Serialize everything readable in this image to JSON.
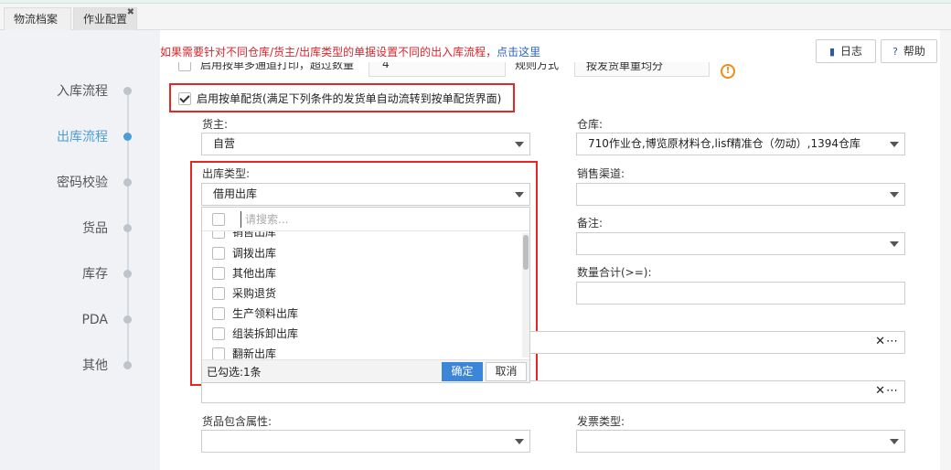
{
  "tabs": [
    {
      "label": "物流档案"
    },
    {
      "label": "作业配置",
      "close": "✖"
    }
  ],
  "sidebar": {
    "items": [
      {
        "label": "入库流程",
        "active": false
      },
      {
        "label": "出库流程",
        "active": true
      },
      {
        "label": "密码校验",
        "active": false
      },
      {
        "label": "货品",
        "active": false
      },
      {
        "label": "库存",
        "active": false
      },
      {
        "label": "PDA",
        "active": false
      },
      {
        "label": "其他",
        "active": false
      }
    ]
  },
  "header": {
    "notice_text": "如果需要针对不同仓库/货主/出库类型的单据设置不同的出入库流程，",
    "notice_link": "点击这里",
    "log_button": "日志",
    "help_button": "帮助",
    "log_icon": "book-icon",
    "help_icon": "question-icon"
  },
  "overlap_row": {
    "text_a": "启用按单多通道打印，超过数量",
    "value_a": "4",
    "text_b": "规则方式",
    "value_b": "按发货单重均分",
    "warn_icon": "!"
  },
  "enable_rule": {
    "label": "启用按单配货(满足下列条件的发货单自动流转到按单配货界面)",
    "checked": true
  },
  "form": {
    "owner_label": "货主:",
    "owner_value": "自营",
    "warehouse_label": "仓库:",
    "warehouse_value": "710作业仓,博览原材料仓,lisf精准仓（勿动）,1394仓库",
    "outbound_type_label": "出库类型:",
    "outbound_type_value": "借用出库",
    "sales_channel_label": "销售渠道:",
    "sales_channel_value": "",
    "remark_label": "备注:",
    "remark_value": "",
    "qty_total_label": "数量合计(>=):",
    "qty_total_value": "",
    "goods_attr_label": "货品包含属性:",
    "goods_attr_value": "",
    "invoice_type_label": "发票类型:",
    "invoice_type_value": "",
    "clear_more": "✕⋯"
  },
  "dropdown": {
    "search_placeholder": "请搜索...",
    "items": [
      {
        "label": "销售出库",
        "checked": false
      },
      {
        "label": "调拨出库",
        "checked": false
      },
      {
        "label": "其他出库",
        "checked": false
      },
      {
        "label": "采购退货",
        "checked": false
      },
      {
        "label": "生产领料出库",
        "checked": false
      },
      {
        "label": "组装拆卸出库",
        "checked": false
      },
      {
        "label": "翻新出库",
        "checked": false
      }
    ],
    "selected_count": "已勾选:1条",
    "ok_label": "确定",
    "cancel_label": "取消"
  },
  "colors": {
    "accent": "#4a9ed8",
    "highlight_border": "#e32626",
    "notice_red": "#d9252b",
    "primary_button": "#3b86d8"
  }
}
